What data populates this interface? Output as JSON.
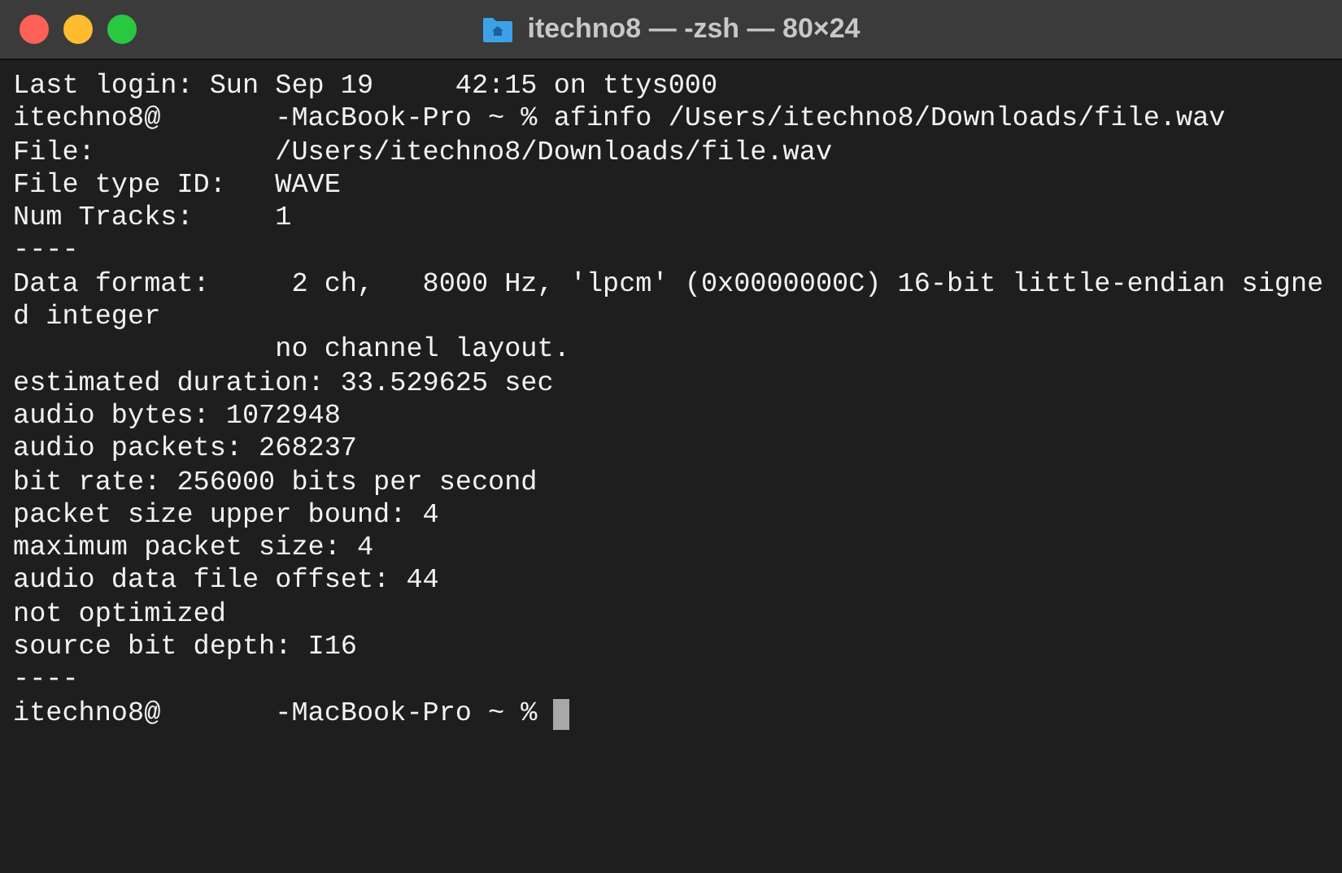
{
  "window": {
    "title": "itechno8 — -zsh — 80×24"
  },
  "terminal": {
    "lines": [
      "Last login: Sun Sep 19     42:15 on ttys000",
      "itechno8@       -MacBook-Pro ~ % afinfo /Users/itechno8/Downloads/file.wav",
      "File:           /Users/itechno8/Downloads/file.wav",
      "File type ID:   WAVE",
      "Num Tracks:     1",
      "----",
      "Data format:     2 ch,   8000 Hz, 'lpcm' (0x0000000C) 16-bit little-endian signe",
      "d integer",
      "                no channel layout.",
      "estimated duration: 33.529625 sec",
      "audio bytes: 1072948",
      "audio packets: 268237",
      "bit rate: 256000 bits per second",
      "packet size upper bound: 4",
      "maximum packet size: 4",
      "audio data file offset: 44",
      "not optimized",
      "source bit depth: I16",
      "----"
    ],
    "prompt": "itechno8@       -MacBook-Pro ~ %"
  }
}
